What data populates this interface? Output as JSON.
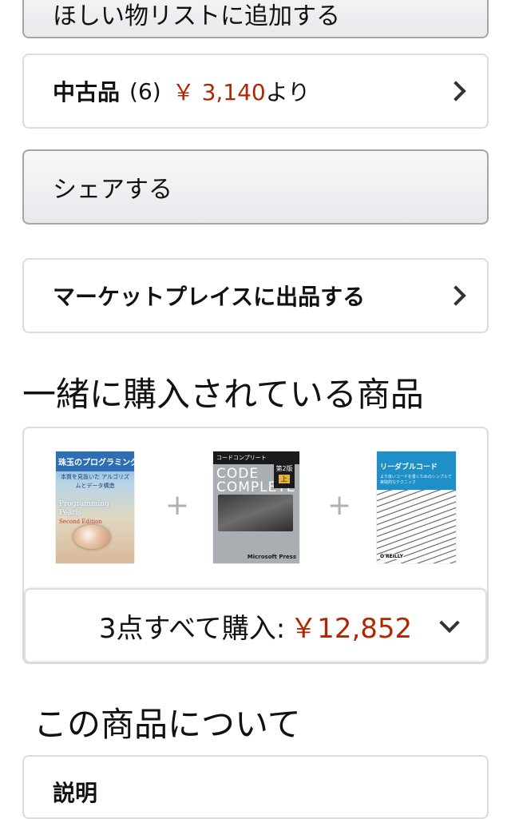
{
  "wishlist_button": {
    "label": "ほしい物リストに追加する"
  },
  "used_offer": {
    "label": "中古品",
    "count": "(6)",
    "price": "￥ 3,140",
    "suffix": "より"
  },
  "share_button": {
    "label": "シェアする"
  },
  "marketplace": {
    "label": "マーケットプレイスに出品する"
  },
  "bought_together": {
    "heading": "一緒に購入されている商品",
    "plus_symbol": "+",
    "books": [
      {
        "title": "珠玉のプログラミング",
        "subtitle": "本質を見抜いた アルゴリズムとデータ構造",
        "en_title": "Programming Pearls",
        "edition": "Second Edition"
      },
      {
        "series": "コードコンプリート",
        "title": "CODE COMPLETE",
        "edition": "第2版",
        "volume": "上",
        "publisher": "Microsoft Press"
      },
      {
        "title": "リーダブルコード",
        "subtitle": "より良いコードを書くためのシンプルで実践的なテクニック",
        "publisher": "O'REILLY"
      }
    ],
    "buy_all_label": "3点すべて購入:",
    "buy_all_price": "￥12,852"
  },
  "about": {
    "heading": "この商品について",
    "description_label": "説明"
  },
  "colors": {
    "price": "#b12704",
    "border": "#dddddd",
    "button_border": "#a6a6a6"
  }
}
